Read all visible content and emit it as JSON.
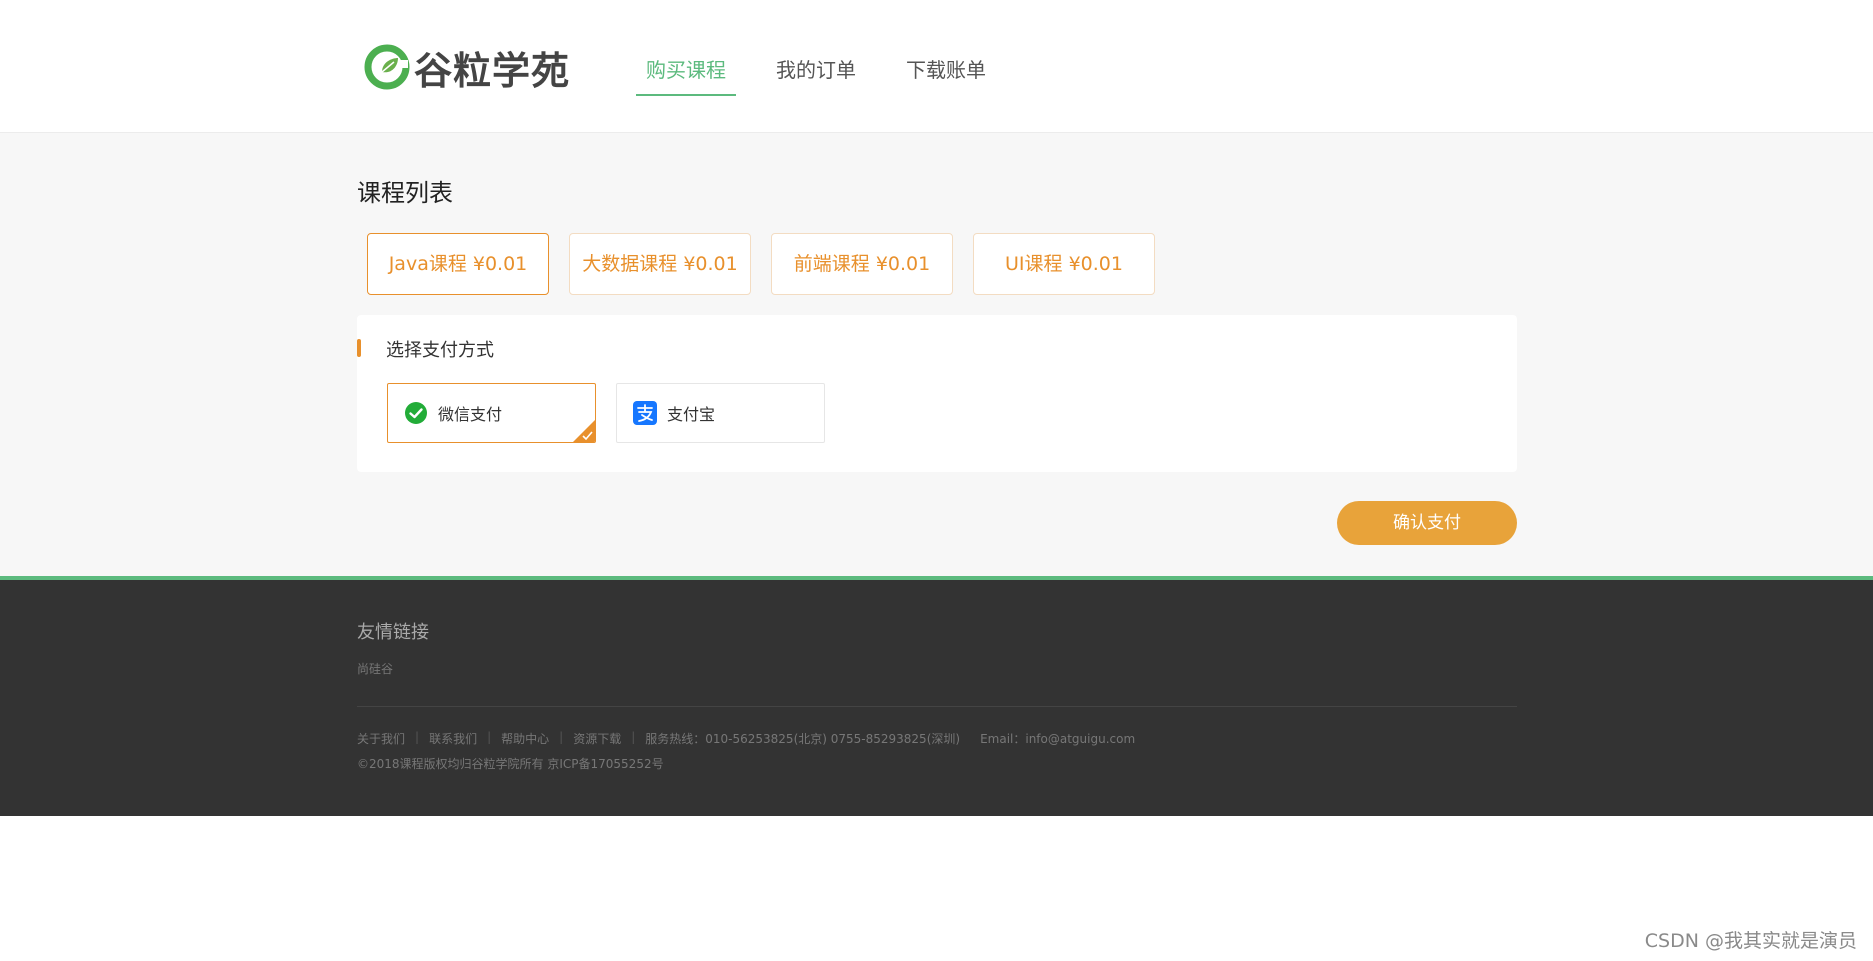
{
  "header": {
    "logo_text": "谷粒学苑",
    "nav": [
      {
        "label": "购买课程",
        "active": true
      },
      {
        "label": "我的订单",
        "active": false
      },
      {
        "label": "下载账单",
        "active": false
      }
    ]
  },
  "main": {
    "section_title": "课程列表",
    "courses": [
      {
        "label": "Java课程 ¥0.01",
        "selected": true
      },
      {
        "label": "大数据课程 ¥0.01",
        "selected": false
      },
      {
        "label": "前端课程 ¥0.01",
        "selected": false
      },
      {
        "label": "UI课程 ¥0.01",
        "selected": false
      }
    ],
    "payment": {
      "title": "选择支付方式",
      "options": [
        {
          "label": "微信支付",
          "icon": "wechat-pay-icon",
          "selected": true
        },
        {
          "label": "支付宝",
          "icon": "alipay-icon",
          "selected": false
        }
      ]
    },
    "confirm_label": "确认支付"
  },
  "footer": {
    "friend_links_title": "友情链接",
    "friend_link": "尚硅谷",
    "links": [
      "关于我们",
      "联系我们",
      "帮助中心",
      "资源下载"
    ],
    "hotline": "服务热线：010-56253825(北京) 0755-85293825(深圳)",
    "email": "Email：info@atguigu.com",
    "copyright": "©2018课程版权均归谷粒学院所有 京ICP备17055252号"
  },
  "watermark": "CSDN @我其实就是演员",
  "colors": {
    "accent_green": "#5cba7e",
    "accent_orange": "#e8902c",
    "confirm_orange": "#e8a33a",
    "footer_bg": "#333333"
  }
}
